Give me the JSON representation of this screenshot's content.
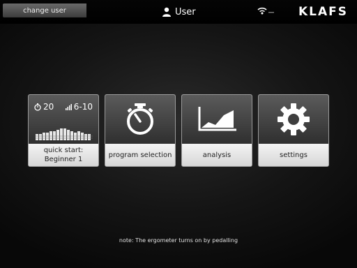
{
  "header": {
    "back_label": "change user",
    "user_label": "User",
    "logo": "KLAFS"
  },
  "tiles": [
    {
      "label_line1": "quick start:",
      "label_line2": "Beginner 1",
      "time": "20",
      "level": "6-10"
    },
    {
      "label": "program selection"
    },
    {
      "label": "analysis"
    },
    {
      "label": "settings"
    }
  ],
  "footer": {
    "note": "note: The ergometer turns on by pedalling"
  },
  "icons": [
    "user-icon",
    "wifi-icon",
    "timer-icon",
    "signal-icon",
    "stopwatch-icon",
    "chart-icon",
    "gear-icon"
  ]
}
